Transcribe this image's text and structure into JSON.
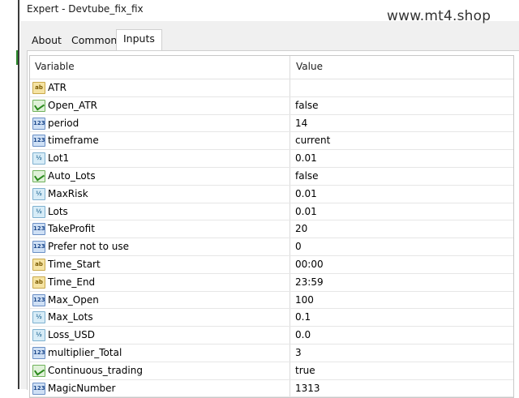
{
  "window": {
    "title": "Expert - Devtube_fix_fix"
  },
  "watermark": "www.mt4.shop",
  "tabs": [
    {
      "label": "About"
    },
    {
      "label": "Common"
    },
    {
      "label": "Inputs",
      "active": true
    }
  ],
  "table": {
    "headers": {
      "variable": "Variable",
      "value": "Value"
    },
    "rows": [
      {
        "icon": "ab-text-icon",
        "name": "ATR",
        "value": ""
      },
      {
        "icon": "bool-icon",
        "name": "Open_ATR",
        "value": "false"
      },
      {
        "icon": "int-icon",
        "name": "period",
        "value": "14"
      },
      {
        "icon": "int-icon",
        "name": "timeframe",
        "value": "current"
      },
      {
        "icon": "double-icon",
        "name": "Lot1",
        "value": "0.01"
      },
      {
        "icon": "bool-icon",
        "name": "Auto_Lots",
        "value": "false"
      },
      {
        "icon": "double-icon",
        "name": "MaxRisk",
        "value": "0.01"
      },
      {
        "icon": "double-icon",
        "name": "Lots",
        "value": "0.01"
      },
      {
        "icon": "int-icon",
        "name": "TakeProfit",
        "value": "20"
      },
      {
        "icon": "int-icon",
        "name": "Prefer not to use",
        "value": "0"
      },
      {
        "icon": "ab-text-icon",
        "name": "Time_Start",
        "value": "00:00"
      },
      {
        "icon": "ab-text-icon",
        "name": "Time_End",
        "value": "23:59"
      },
      {
        "icon": "int-icon",
        "name": "Max_Open",
        "value": "100"
      },
      {
        "icon": "double-icon",
        "name": "Max_Lots",
        "value": "0.1"
      },
      {
        "icon": "double-icon",
        "name": "Loss_USD",
        "value": "0.0"
      },
      {
        "icon": "int-icon",
        "name": "multiplier_Total",
        "value": "3"
      },
      {
        "icon": "bool-icon",
        "name": "Continuous_trading",
        "value": "true"
      },
      {
        "icon": "int-icon",
        "name": "MagicNumber",
        "value": "1313"
      }
    ]
  }
}
